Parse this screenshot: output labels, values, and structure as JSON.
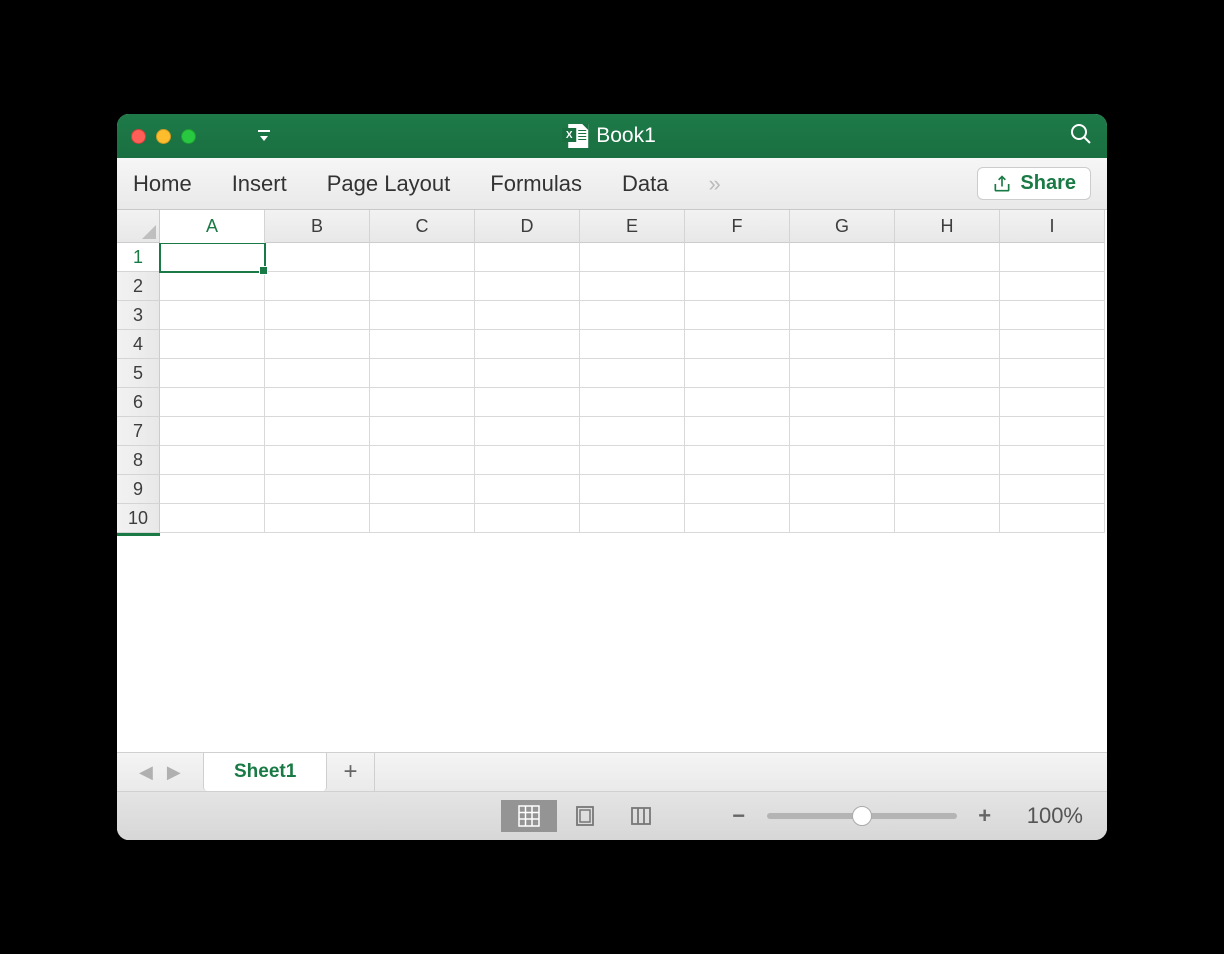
{
  "title": "Book1",
  "ribbon": {
    "tabs": [
      "Home",
      "Insert",
      "Page Layout",
      "Formulas",
      "Data"
    ],
    "share_label": "Share"
  },
  "columns": [
    "A",
    "B",
    "C",
    "D",
    "E",
    "F",
    "G",
    "H",
    "I"
  ],
  "rows": [
    "1",
    "2",
    "3",
    "4",
    "5",
    "6",
    "7",
    "8",
    "9",
    "10"
  ],
  "selected_cell": {
    "col": 0,
    "row": 0
  },
  "sheet_tabs": {
    "active": "Sheet1"
  },
  "status": {
    "zoom": "100%"
  }
}
